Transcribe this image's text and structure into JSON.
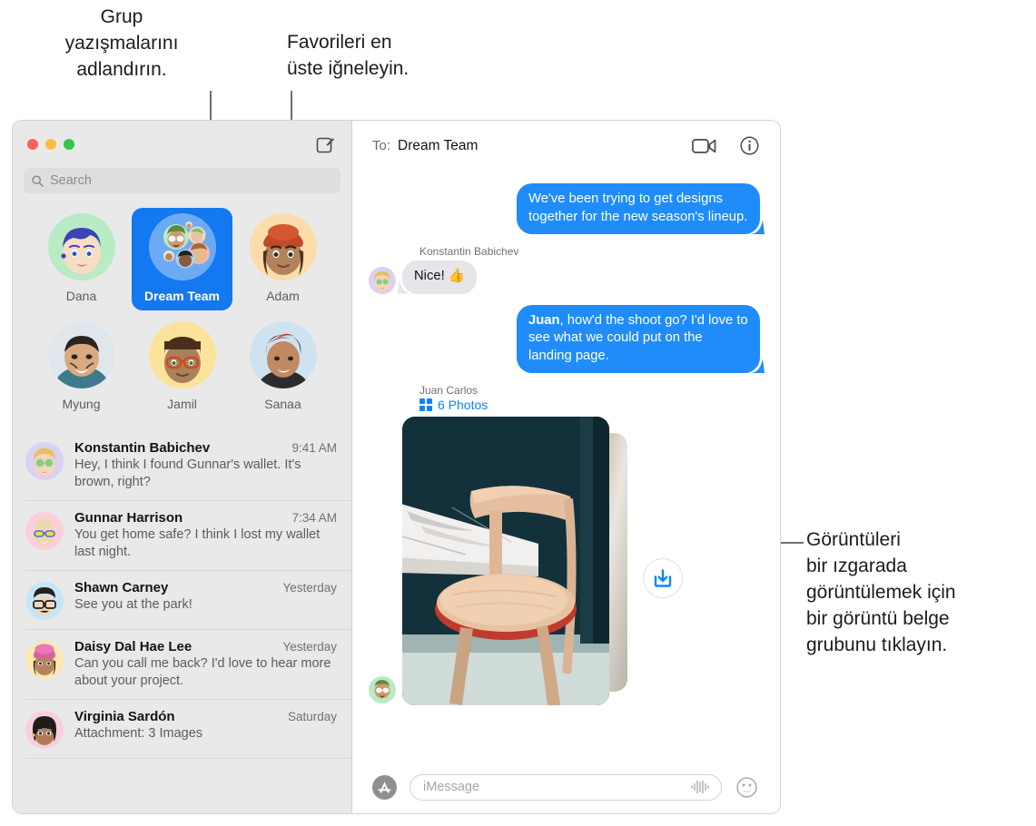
{
  "callouts": {
    "group_naming": "Grup\nyazışmalarını\nadlandırın.",
    "pin_favorites": "Favorileri en\nüste iğneleyin.",
    "image_grid": "Görüntüleri\nbir ızgarada\ngörüntülemek için\nbir görüntü belge\ngrubunu tıklayın."
  },
  "window": {
    "traffic_lights": {
      "close": "close-button",
      "minimize": "minimize-button",
      "maximize": "maximize-button"
    }
  },
  "sidebar": {
    "compose_icon": "compose-icon",
    "search": {
      "icon": "search-icon",
      "placeholder": "Search",
      "value": ""
    },
    "pinned": [
      {
        "label": "Dana",
        "selected": false,
        "avatar_bg": "#b9ebc4"
      },
      {
        "label": "Dream Team",
        "selected": true,
        "avatar_bg": "#6cabf3"
      },
      {
        "label": "Adam",
        "selected": false,
        "avatar_bg": "#fcdcab"
      },
      {
        "label": "Myung",
        "selected": false,
        "avatar_bg": "#f2f2f0"
      },
      {
        "label": "Jamil",
        "selected": false,
        "avatar_bg": "#fbe39b"
      },
      {
        "label": "Sanaa",
        "selected": false,
        "avatar_bg": "#dbe9f3"
      }
    ],
    "conversations": [
      {
        "name": "Konstantin Babichev",
        "time": "9:41 AM",
        "preview": "Hey, I think I found Gunnar's wallet. It's brown, right?",
        "avatar_bg": "#dcd1f0"
      },
      {
        "name": "Gunnar Harrison",
        "time": "7:34 AM",
        "preview": "You get home safe? I think I lost my wallet last night.",
        "avatar_bg": "#fbcedd"
      },
      {
        "name": "Shawn Carney",
        "time": "Yesterday",
        "preview": "See you at the park!",
        "avatar_bg": "#c6e6f7"
      },
      {
        "name": "Daisy Dal Hae Lee",
        "time": "Yesterday",
        "preview": "Can you call me back? I'd love to hear more about your project.",
        "avatar_bg": "#fbe8b2"
      },
      {
        "name": "Virginia Sardón",
        "time": "Saturday",
        "preview": "Attachment: 3 Images",
        "avatar_bg": "#fbcedd"
      }
    ]
  },
  "chat": {
    "header": {
      "to_label": "To:",
      "to_value": "Dream Team",
      "facetime_icon": "video-camera-icon",
      "details_icon": "info-icon"
    },
    "messages": [
      {
        "kind": "outgoing",
        "text": "We've been trying to get designs together for the new season's lineup."
      },
      {
        "kind": "incoming",
        "sender": "Konstantin Babichev",
        "text": "Nice! 👍",
        "avatar_bg": "#dcd1f0"
      },
      {
        "kind": "outgoing",
        "bold_prefix": "Juan",
        "text": ", how'd the shoot go? I'd love to see what we could put on the landing page."
      }
    ],
    "attachment": {
      "sender": "Juan Carlos",
      "photos_label": "6 Photos",
      "photos_icon": "grid-icon",
      "download_icon": "download-icon",
      "avatar_bg": "#b9ebc4"
    },
    "composer": {
      "appstore_icon": "app-store-icon",
      "input_placeholder": "iMessage",
      "input_value": "",
      "audio_icon": "audio-waveform-icon",
      "emoji_icon": "smiley-icon"
    }
  },
  "colors": {
    "accent_blue": "#1f8cf9",
    "selected_pin": "#1478f0",
    "link_blue": "#0a84ff",
    "incoming_bubble": "#e6e5ea",
    "sidebar_bg": "#e9e9e9"
  }
}
